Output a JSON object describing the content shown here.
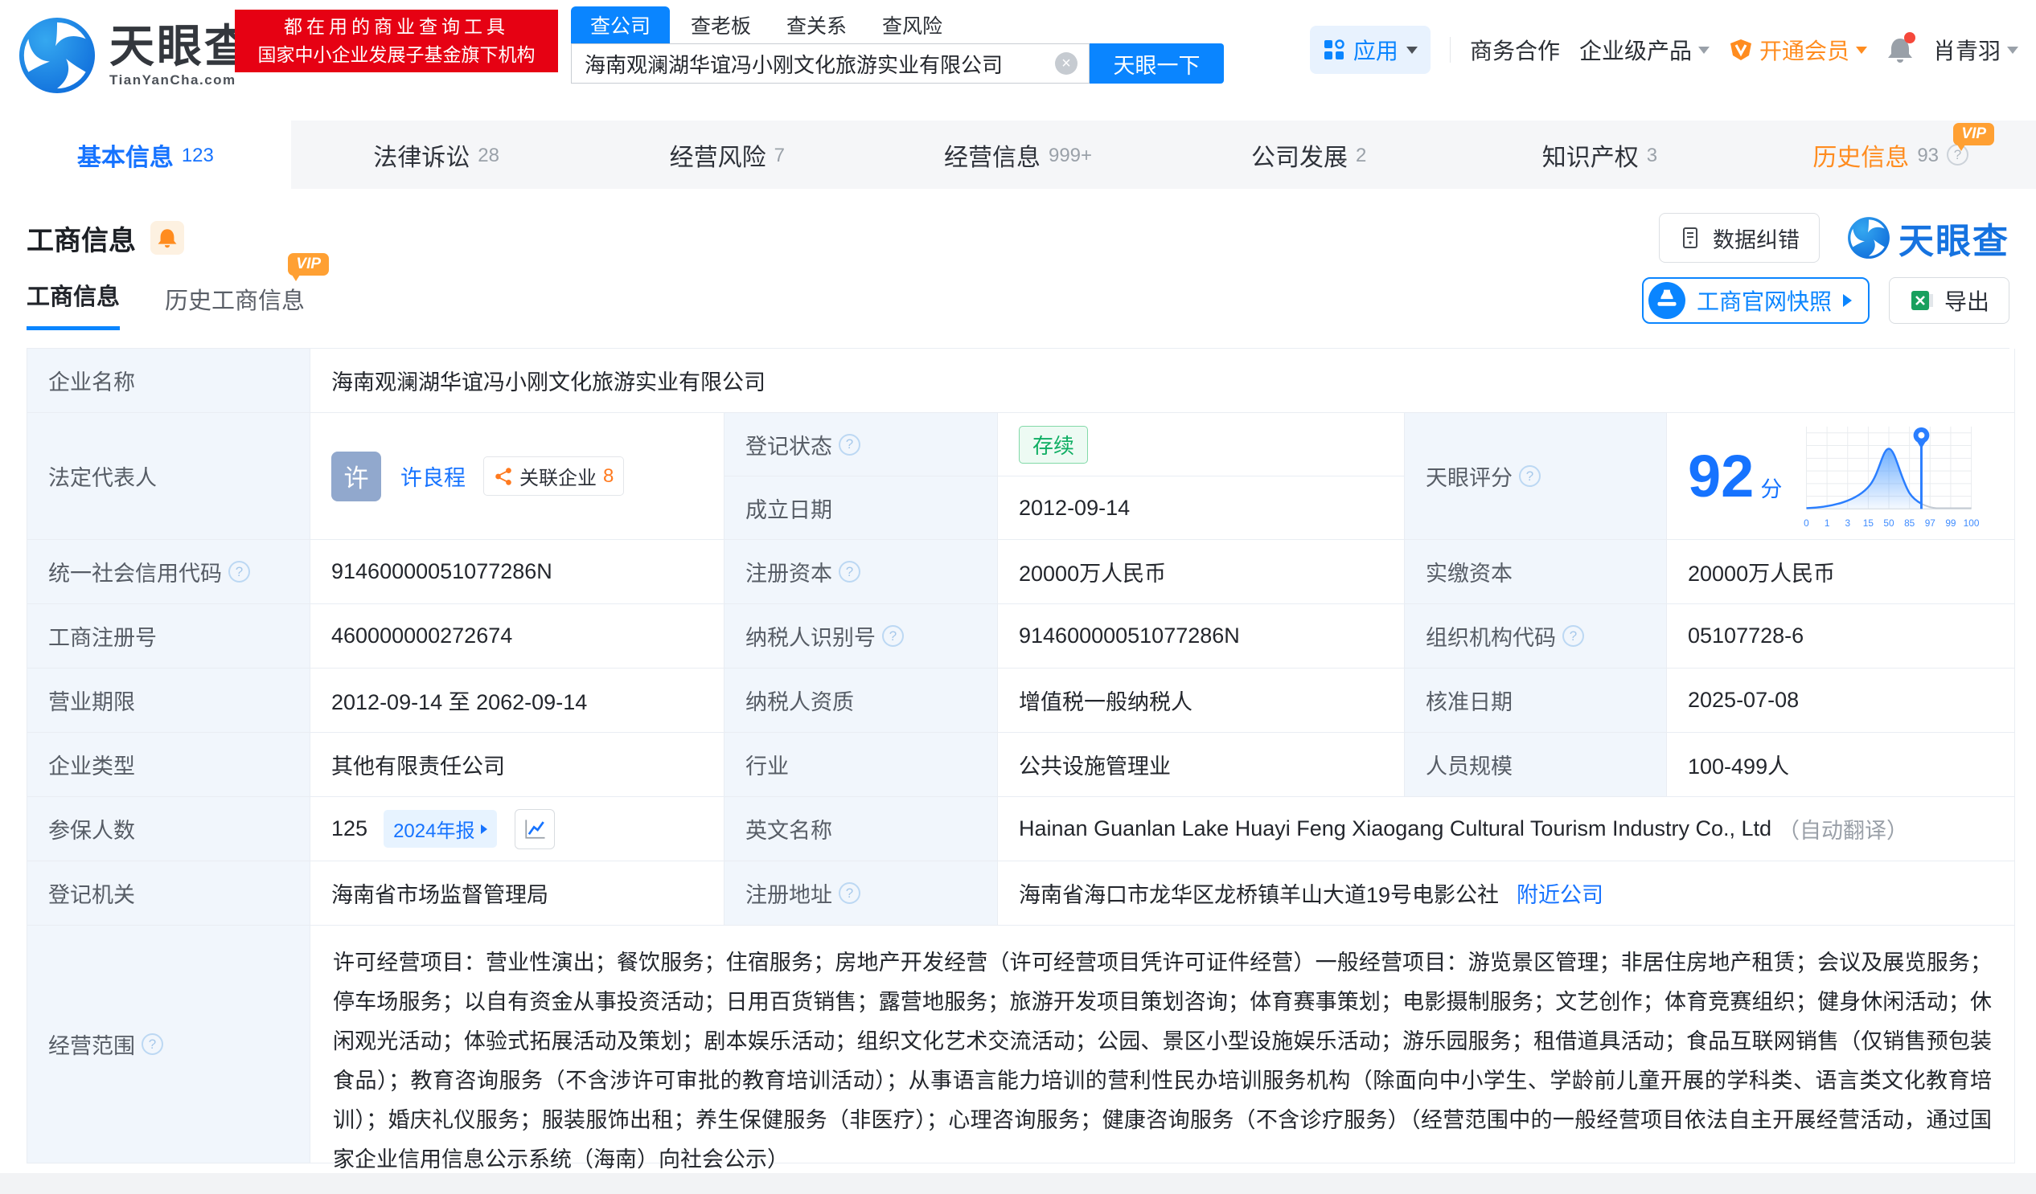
{
  "header": {
    "logo": {
      "brand": "天眼查",
      "domain": "TianYanCha.com"
    },
    "promo": {
      "line1": "都在用的商业查询工具",
      "line2": "国家中小企业发展子基金旗下机构"
    },
    "search": {
      "tabs": [
        "查公司",
        "查老板",
        "查关系",
        "查风险"
      ],
      "value": "海南观澜湖华谊冯小刚文化旅游实业有限公司",
      "button": "天眼一下"
    },
    "nav": {
      "apps": "应用",
      "cooperation": "商务合作",
      "enterprise": "企业级产品",
      "vip": "开通会员",
      "user": "肖青羽"
    }
  },
  "badges": {
    "vip": "VIP"
  },
  "icons": {
    "help": "?",
    "clear": "×"
  },
  "tabs": [
    {
      "label": "基本信息",
      "count": "123"
    },
    {
      "label": "法律诉讼",
      "count": "28"
    },
    {
      "label": "经营风险",
      "count": "7"
    },
    {
      "label": "经营信息",
      "count": "999+"
    },
    {
      "label": "公司发展",
      "count": "2"
    },
    {
      "label": "知识产权",
      "count": "3"
    },
    {
      "label": "历史信息",
      "count": "93"
    }
  ],
  "section": {
    "title": "工商信息",
    "subtabs": [
      {
        "label": "工商信息"
      },
      {
        "label": "历史工商信息"
      }
    ],
    "actions": {
      "correction": "数据纠错",
      "snapshot": "工商官网快照",
      "export": "导出"
    }
  },
  "table": {
    "company_name": {
      "label": "企业名称",
      "value": "海南观澜湖华谊冯小刚文化旅游实业有限公司"
    },
    "legal_rep": {
      "label": "法定代表人",
      "avatar": "许",
      "name": "许良程",
      "related_label": "关联企业",
      "related_count": "8"
    },
    "reg_status": {
      "label": "登记状态",
      "value": "存续"
    },
    "est_date": {
      "label": "成立日期",
      "value": "2012-09-14"
    },
    "score": {
      "label": "天眼评分",
      "value": "92",
      "unit": "分"
    },
    "credit_code": {
      "label": "统一社会信用代码",
      "value": "91460000051077286N"
    },
    "reg_capital": {
      "label": "注册资本",
      "value": "20000万人民币"
    },
    "paid_capital": {
      "label": "实缴资本",
      "value": "20000万人民币"
    },
    "reg_number": {
      "label": "工商注册号",
      "value": "460000000272674"
    },
    "taxpayer_id": {
      "label": "纳税人识别号",
      "value": "91460000051077286N"
    },
    "org_code": {
      "label": "组织机构代码",
      "value": "05107728-6"
    },
    "business_term": {
      "label": "营业期限",
      "value": "2012-09-14 至 2062-09-14"
    },
    "taxpayer_quality": {
      "label": "纳税人资质",
      "value": "增值税一般纳税人"
    },
    "approval_date": {
      "label": "核准日期",
      "value": "2025-07-08"
    },
    "company_type": {
      "label": "企业类型",
      "value": "其他有限责任公司"
    },
    "industry": {
      "label": "行业",
      "value": "公共设施管理业"
    },
    "staff_size": {
      "label": "人员规模",
      "value": "100-499人"
    },
    "insured_count": {
      "label": "参保人数",
      "value": "125",
      "report": "2024年报"
    },
    "english_name": {
      "label": "英文名称",
      "value": "Hainan Guanlan Lake Huayi Feng Xiaogang Cultural Tourism Industry Co., Ltd",
      "note": "（自动翻译）"
    },
    "reg_authority": {
      "label": "登记机关",
      "value": "海南省市场监督管理局"
    },
    "address": {
      "label": "注册地址",
      "value": "海南省海口市龙华区龙桥镇羊山大道19号电影公社",
      "link": "附近公司"
    },
    "business_scope": {
      "label": "经营范围",
      "value": "许可经营项目：营业性演出；餐饮服务；住宿服务；房地产开发经营（许可经营项目凭许可证件经营）一般经营项目：游览景区管理；非居住房地产租赁；会议及展览服务；停车场服务；以自有资金从事投资活动；日用百货销售；露营地服务；旅游开发项目策划咨询；体育赛事策划；电影摄制服务；文艺创作；体育竞赛组织；健身休闲活动；休闲观光活动；体验式拓展活动及策划；剧本娱乐活动；组织文化艺术交流活动；公园、景区小型设施娱乐活动；游乐园服务；租借道具活动；食品互联网销售（仅销售预包装食品）；教育咨询服务（不含涉许可审批的教育培训活动）；从事语言能力培训的营利性民办培训服务机构（除面向中小学生、学龄前儿童开展的学科类、语言类文化教育培训）；婚庆礼仪服务；服装服饰出租；养生保健服务（非医疗）；心理咨询服务；健康咨询服务（不含诊疗服务）（经营范围中的一般经营项目依法自主开展经营活动，通过国家企业信用信息公示系统（海南）向社会公示）"
    }
  },
  "score_chart": {
    "ticks": [
      "0",
      "1",
      "3",
      "15",
      "50",
      "85",
      "97",
      "99",
      "100"
    ],
    "score": 92
  }
}
